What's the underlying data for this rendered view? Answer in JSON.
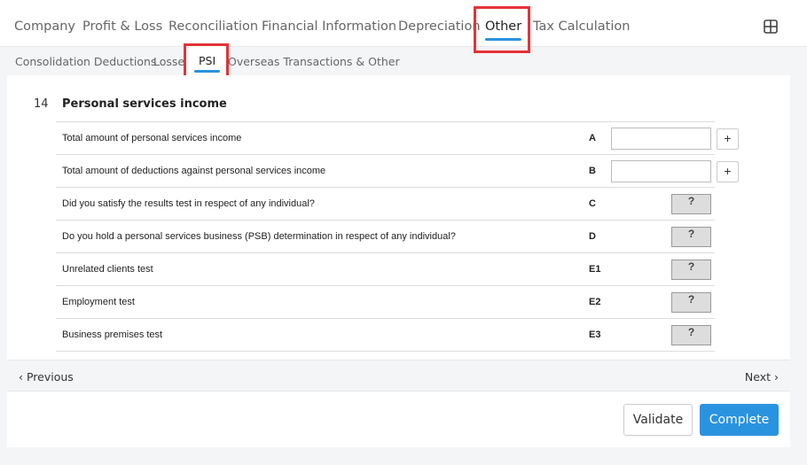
{
  "top_tabs": [
    "Company",
    "Profit & Loss",
    "Reconciliation",
    "Financial Information",
    "Depreciation",
    "Other",
    "Tax Calculation"
  ],
  "active_top_tab": "Other",
  "sub_tabs": [
    "Consolidation Deductions",
    "Losses",
    "PSI",
    "Overseas Transactions & Other"
  ],
  "active_sub_tab": "PSI",
  "section": {
    "number": "14",
    "title": "Personal services income"
  },
  "rows": [
    {
      "label": "Total amount of personal services income",
      "code": "A",
      "type": "input",
      "value": ""
    },
    {
      "label": "Total amount of deductions against personal services income",
      "code": "B",
      "type": "input",
      "value": ""
    },
    {
      "label": "Did you satisfy the results test in respect of any individual?",
      "code": "C",
      "type": "question",
      "value": "?"
    },
    {
      "label": "Do you hold a personal services business (PSB) determination in respect of any individual?",
      "code": "D",
      "type": "question",
      "value": "?"
    },
    {
      "label": "Unrelated clients test",
      "code": "E1",
      "type": "question",
      "value": "?"
    },
    {
      "label": "Employment test",
      "code": "E2",
      "type": "question",
      "value": "?"
    },
    {
      "label": "Business premises test",
      "code": "E3",
      "type": "question",
      "value": "?"
    }
  ],
  "plus_label": "+",
  "nav": {
    "previous": "Previous",
    "next": "Next"
  },
  "buttons": {
    "validate": "Validate",
    "complete": "Complete"
  },
  "colors": {
    "accent": "#2a93e0",
    "highlight": "#e53238"
  },
  "icons": {
    "layout": "grid-layout-icon",
    "previous": "chevron-left-icon",
    "next": "chevron-right-icon"
  }
}
